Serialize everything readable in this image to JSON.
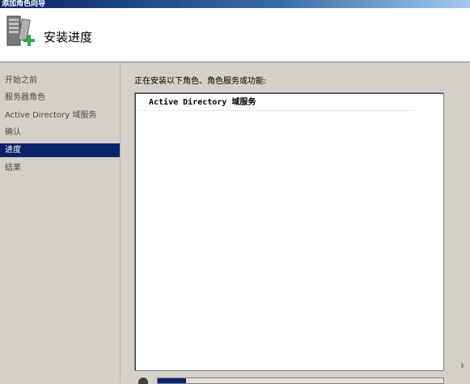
{
  "window": {
    "title": "添加角色向导"
  },
  "header": {
    "title": "安装进度",
    "icon": "server-install-icon"
  },
  "sidebar": {
    "items": [
      {
        "label": "开始之前",
        "active": false
      },
      {
        "label": "服务器角色",
        "active": false
      },
      {
        "label": "Active Directory 域服务",
        "active": false
      },
      {
        "label": "确认",
        "active": false
      },
      {
        "label": "进度",
        "active": true
      },
      {
        "label": "结果",
        "active": false
      }
    ]
  },
  "main": {
    "heading": "正在安装以下角色、角色服务或功能:",
    "list": [
      {
        "label": "Active Directory 域服务"
      }
    ],
    "progress": 0.1
  },
  "colors": {
    "accent": "#0a246a",
    "background": "#d4d0c8"
  }
}
